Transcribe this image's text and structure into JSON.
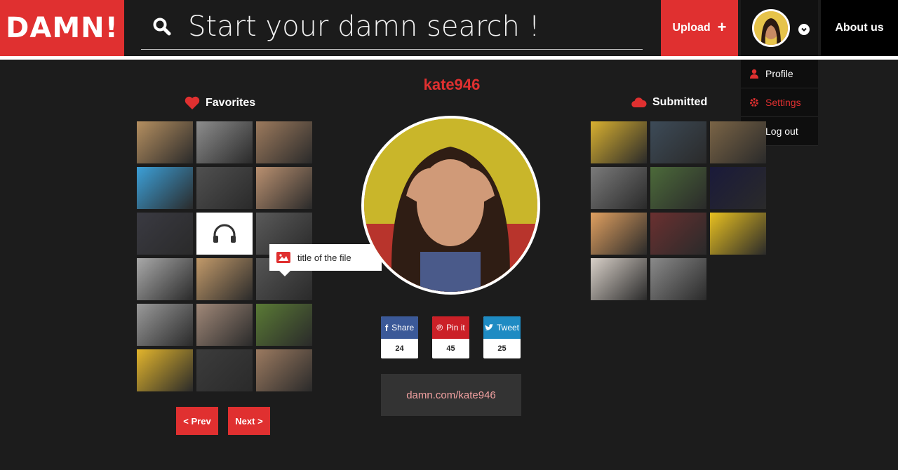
{
  "header": {
    "logo": "DAMN!",
    "search_placeholder": "Start your damn search !",
    "upload_label": "Upload",
    "about_label": "About us"
  },
  "dropdown": {
    "items": [
      {
        "label": "Profile",
        "icon": "user-icon"
      },
      {
        "label": "Settings",
        "icon": "gear-icon"
      },
      {
        "label": "Log out",
        "icon": "power-icon"
      }
    ]
  },
  "profile": {
    "username": "kate946",
    "url": "damn.com/kate946"
  },
  "favorites": {
    "title": "Favorites",
    "tooltip": "title of the file",
    "prev_label": "< Prev",
    "next_label": "Next >",
    "tiles": [
      "#b58f60",
      "#8d8d8d",
      "#9c7a5d",
      "#3ca0d8",
      "#505050",
      "#b99070",
      "#3a3a42",
      "#ffffff",
      "#5a5a5a",
      "#a9a9a9",
      "#c29a6a",
      "#555555",
      "#9a9a9a",
      "#a08878",
      "#5a7a35",
      "#e2b52c",
      "#3c3c3c",
      "#9b7a60"
    ]
  },
  "submitted": {
    "title": "Submitted",
    "tiles": [
      "#d8b030",
      "#3d4b58",
      "#7a6446",
      "#7a7a7a",
      "#4c6a3a",
      "#1a1a3a",
      "#e0a060",
      "#6a3030",
      "#e8c020",
      "#d8d0c8",
      "#8a8a8a"
    ]
  },
  "social": [
    {
      "label": "Share",
      "count": "24",
      "color": "#3b5998",
      "icon": "facebook-icon"
    },
    {
      "label": "Pin it",
      "count": "45",
      "color": "#cb2027",
      "icon": "pinterest-icon"
    },
    {
      "label": "Tweet",
      "count": "25",
      "color": "#1e8bc3",
      "icon": "twitter-icon"
    }
  ]
}
